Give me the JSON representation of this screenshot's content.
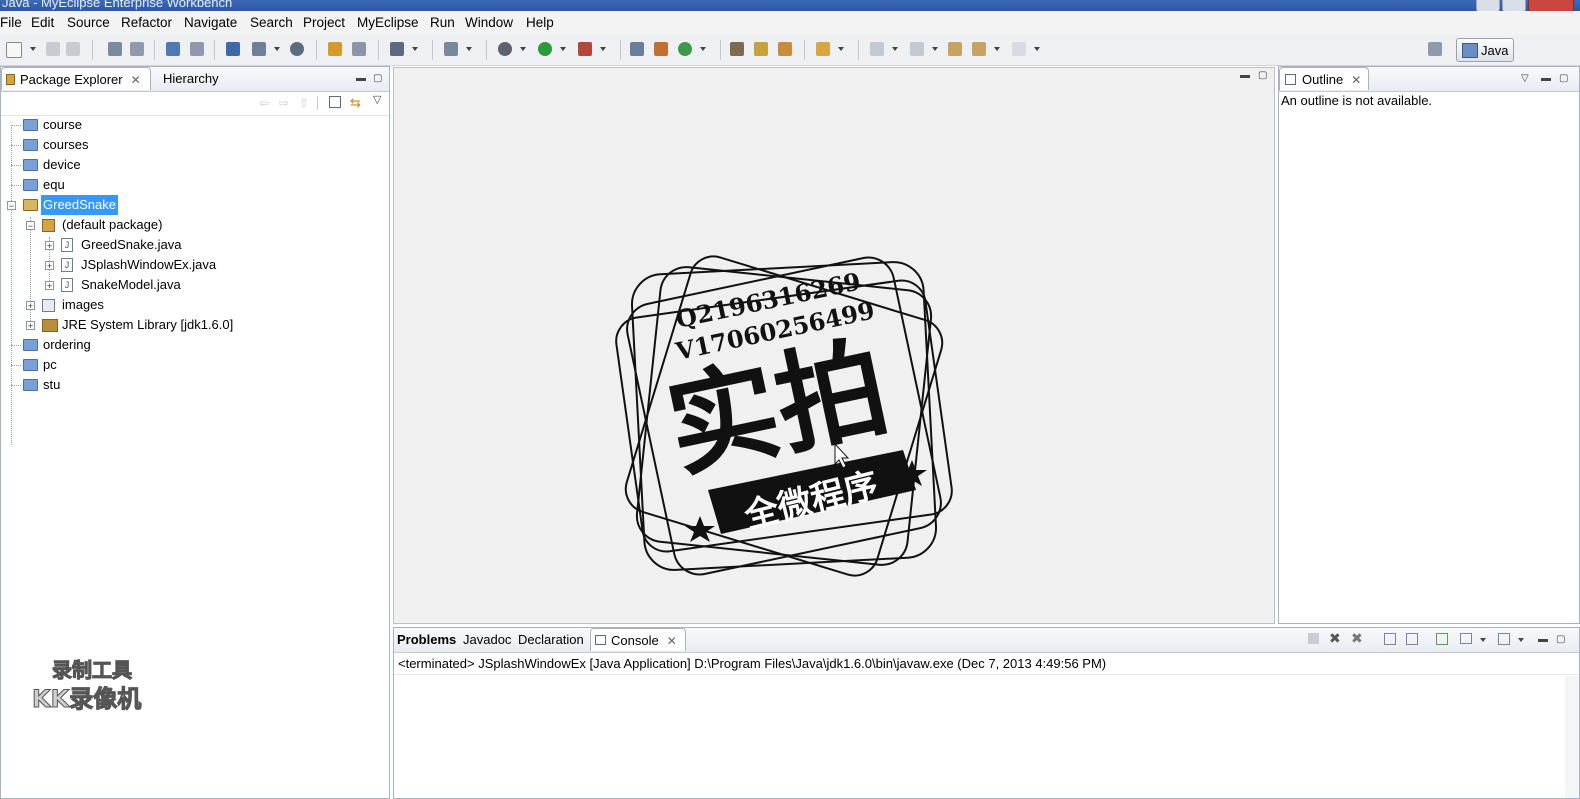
{
  "window": {
    "title": "Java - MyEclipse Enterprise Workbench"
  },
  "menu": [
    "File",
    "Edit",
    "Source",
    "Refactor",
    "Navigate",
    "Search",
    "Project",
    "MyEclipse",
    "Run",
    "Window",
    "Help"
  ],
  "perspective": {
    "label": "Java"
  },
  "left_panel": {
    "tabs": [
      {
        "label": "Package Explorer"
      },
      {
        "label": "Hierarchy"
      }
    ],
    "tree": [
      {
        "label": "course"
      },
      {
        "label": "courses"
      },
      {
        "label": "device"
      },
      {
        "label": "equ"
      },
      {
        "label": "GreedSnake",
        "selected": true
      },
      {
        "label": "(default package)"
      },
      {
        "label": "GreedSnake.java"
      },
      {
        "label": "JSplashWindowEx.java"
      },
      {
        "label": "SnakeModel.java"
      },
      {
        "label": "images"
      },
      {
        "label": "JRE System Library [jdk1.6.0]"
      },
      {
        "label": "ordering"
      },
      {
        "label": "pc"
      },
      {
        "label": "stu"
      }
    ]
  },
  "outline_panel": {
    "tab": "Outline",
    "message": "An outline is not available."
  },
  "bottom_panel": {
    "tabs": [
      "Problems",
      "Javadoc",
      "Declaration",
      "Console"
    ],
    "console_line": "<terminated> JSplashWindowEx [Java Application] D:\\Program Files\\Java\\jdk1.6.0\\bin\\javaw.exe (Dec 7, 2013 4:49:56 PM)"
  },
  "stamp": {
    "line1": "Q2196316269",
    "line2": "V17060256499",
    "big_text": "实拍",
    "banner_text": "全微程序"
  },
  "watermark": {
    "line1": "录制工具",
    "line2": "KK录像机"
  },
  "colors": {
    "selection": "#3399ff",
    "title_bar": "#2c58a3",
    "panel_border": "#a8b2c0"
  }
}
